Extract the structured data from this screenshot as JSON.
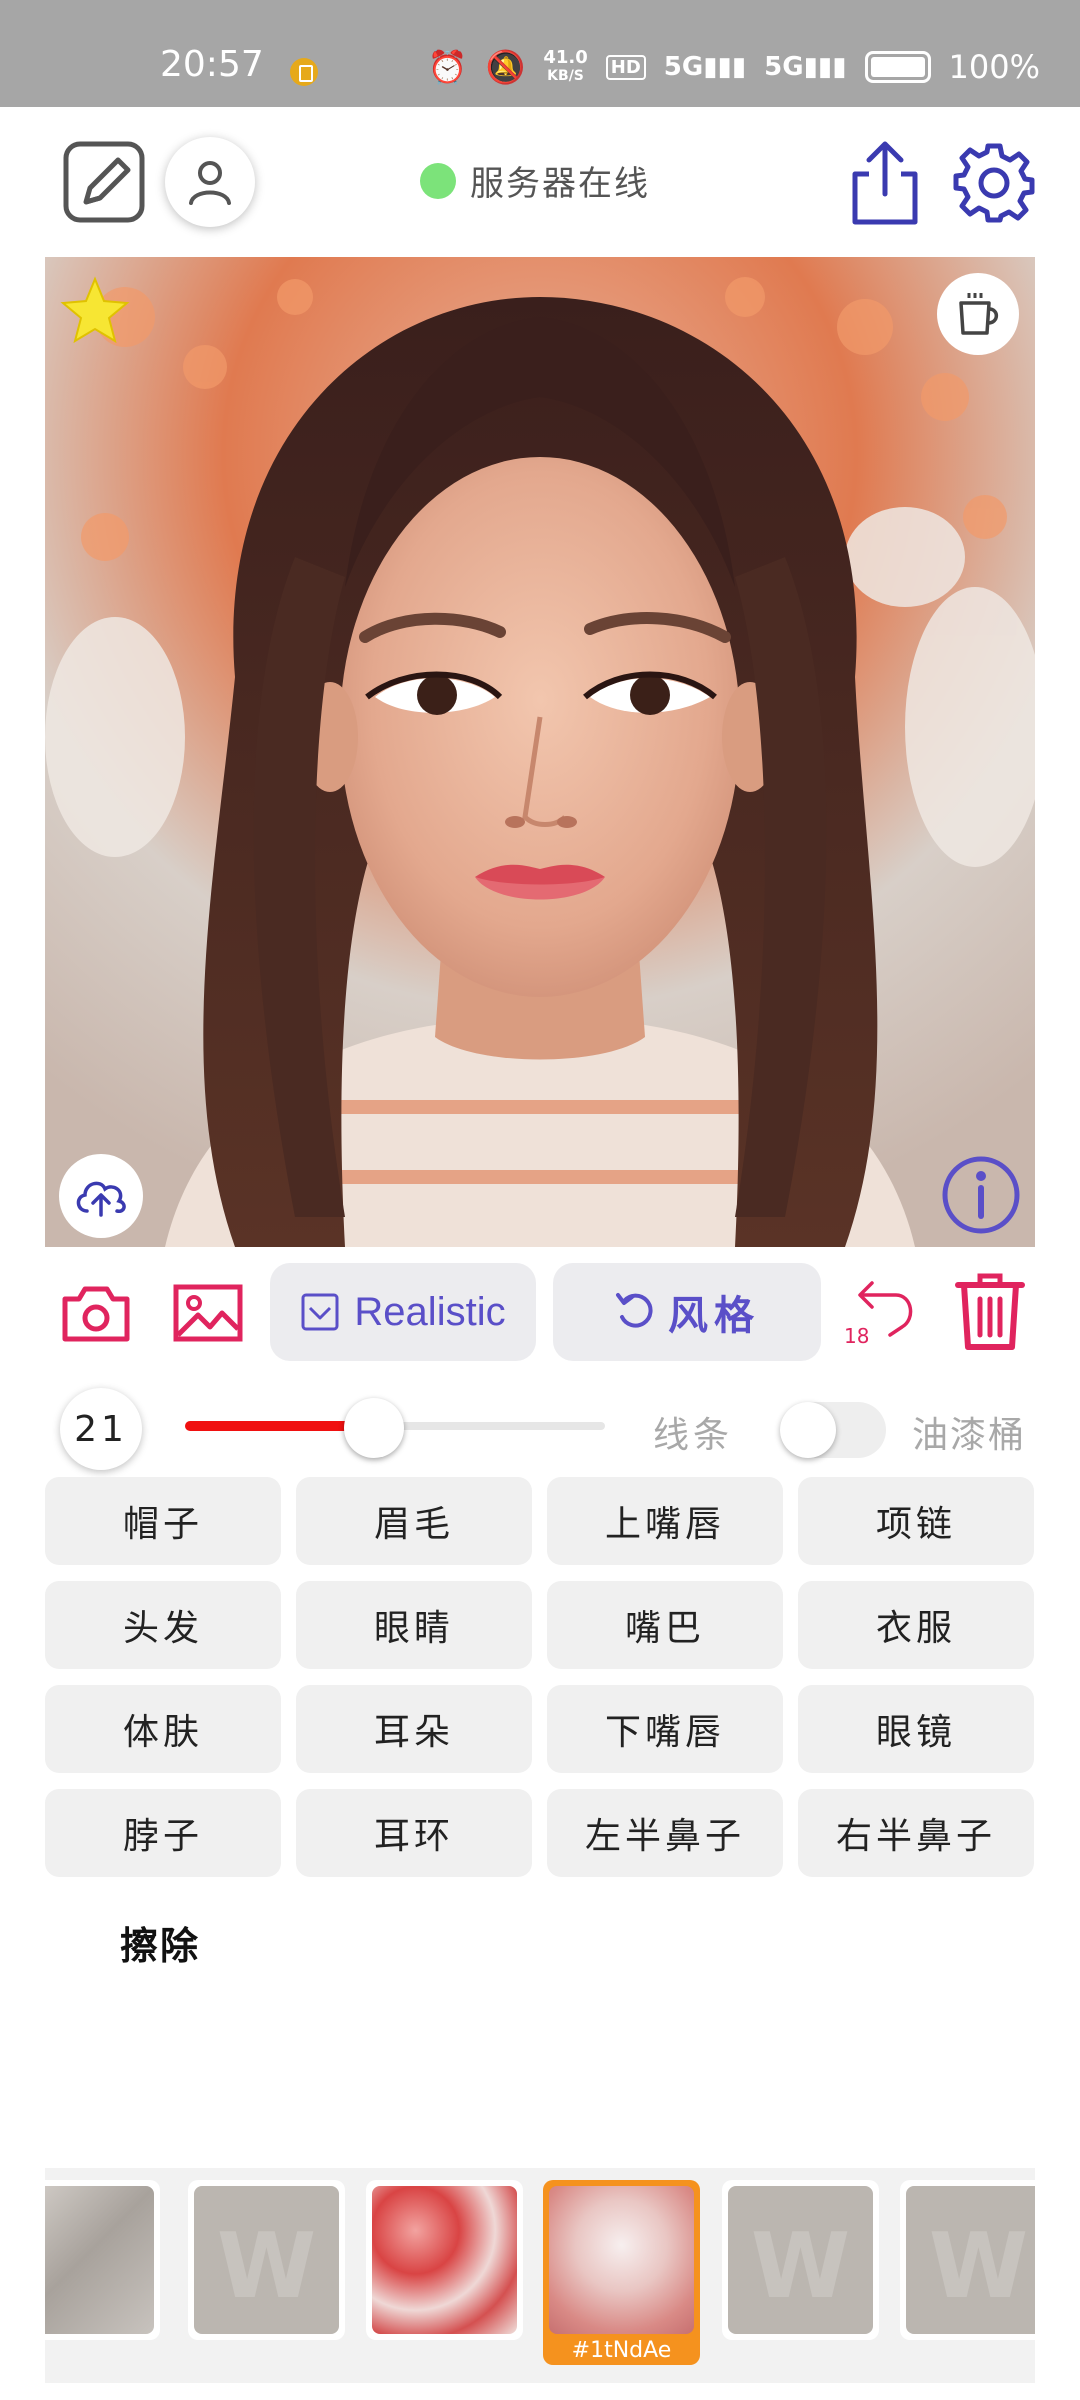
{
  "status_bar": {
    "time": "20:57",
    "speed_value": "41.0",
    "speed_unit": "KB/S",
    "hd_label": "HD",
    "signal_1": "5G",
    "signal_2": "5G",
    "battery": "100%"
  },
  "header": {
    "server_status": "服务器在线",
    "server_status_color": "#7ce37a"
  },
  "toolbar": {
    "style_mode": "Realistic",
    "style_button": "风格",
    "undo_count": "18"
  },
  "brush": {
    "size": "21",
    "size_fraction": 0.45,
    "line_label": "线条",
    "bucket_label": "油漆桶",
    "bucket_enabled": false
  },
  "parts": [
    "帽子",
    "眉毛",
    "上嘴唇",
    "项链",
    "头发",
    "眼睛",
    "嘴巴",
    "衣服",
    "体肤",
    "耳朵",
    "下嘴唇",
    "眼镜",
    "脖子",
    "耳环",
    "左半鼻子",
    "右半鼻子"
  ],
  "erase_label": "擦除",
  "thumbnails": {
    "selected_label": "#1tNdAe",
    "watermark": "W"
  },
  "colors": {
    "accent_red": "#e0245e",
    "accent_purple": "#5a4fc8",
    "slider_fill": "#f01010",
    "selected_thumb": "#f5921e"
  }
}
